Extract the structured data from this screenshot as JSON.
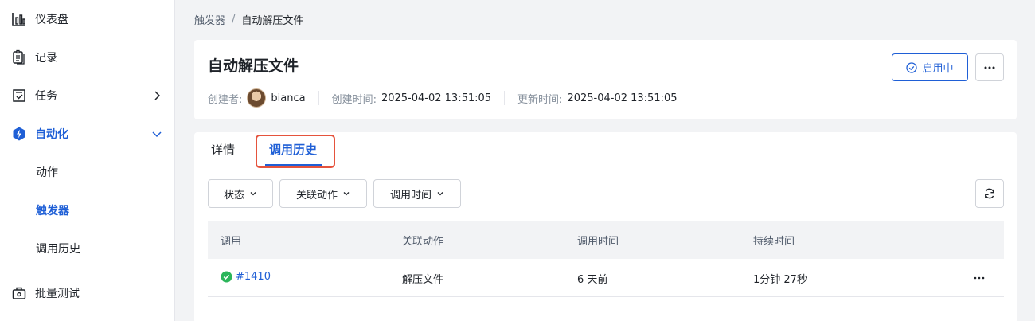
{
  "sidebar": {
    "items": [
      {
        "label": "仪表盘",
        "icon": "bar-chart-icon"
      },
      {
        "label": "记录",
        "icon": "clipboard-icon"
      },
      {
        "label": "任务",
        "icon": "task-icon"
      },
      {
        "label": "自动化",
        "icon": "automation-icon"
      },
      {
        "label": "动作"
      },
      {
        "label": "触发器"
      },
      {
        "label": "调用历史"
      },
      {
        "label": "批量测试",
        "icon": "batch-test-icon"
      }
    ],
    "active_color": "#1f5fd6"
  },
  "breadcrumb": {
    "parent": "触发器",
    "separator": "/",
    "current": "自动解压文件"
  },
  "header": {
    "title": "自动解压文件",
    "creator_label": "创建者:",
    "creator_name": "bianca",
    "created_label": "创建时间:",
    "created_value": "2025-04-02 13:51:05",
    "updated_label": "更新时间:",
    "updated_value": "2025-04-02 13:51:05",
    "status_label": "启用中",
    "more_icon": "more-horizontal-icon"
  },
  "tabs": [
    {
      "label": "详情",
      "active": false
    },
    {
      "label": "调用历史",
      "active": true
    }
  ],
  "filters": [
    {
      "label": "状态"
    },
    {
      "label": "关联动作"
    },
    {
      "label": "调用时间"
    }
  ],
  "table": {
    "headers": [
      "调用",
      "关联动作",
      "调用时间",
      "持续时间"
    ],
    "rows": [
      {
        "status": "success",
        "id": "#1410",
        "action": "解压文件",
        "time": "6 天前",
        "duration": "1分钟 27秒"
      }
    ]
  },
  "colors": {
    "primary": "#1f5fd6",
    "success": "#2bb55a",
    "highlight": "#e5533d"
  }
}
